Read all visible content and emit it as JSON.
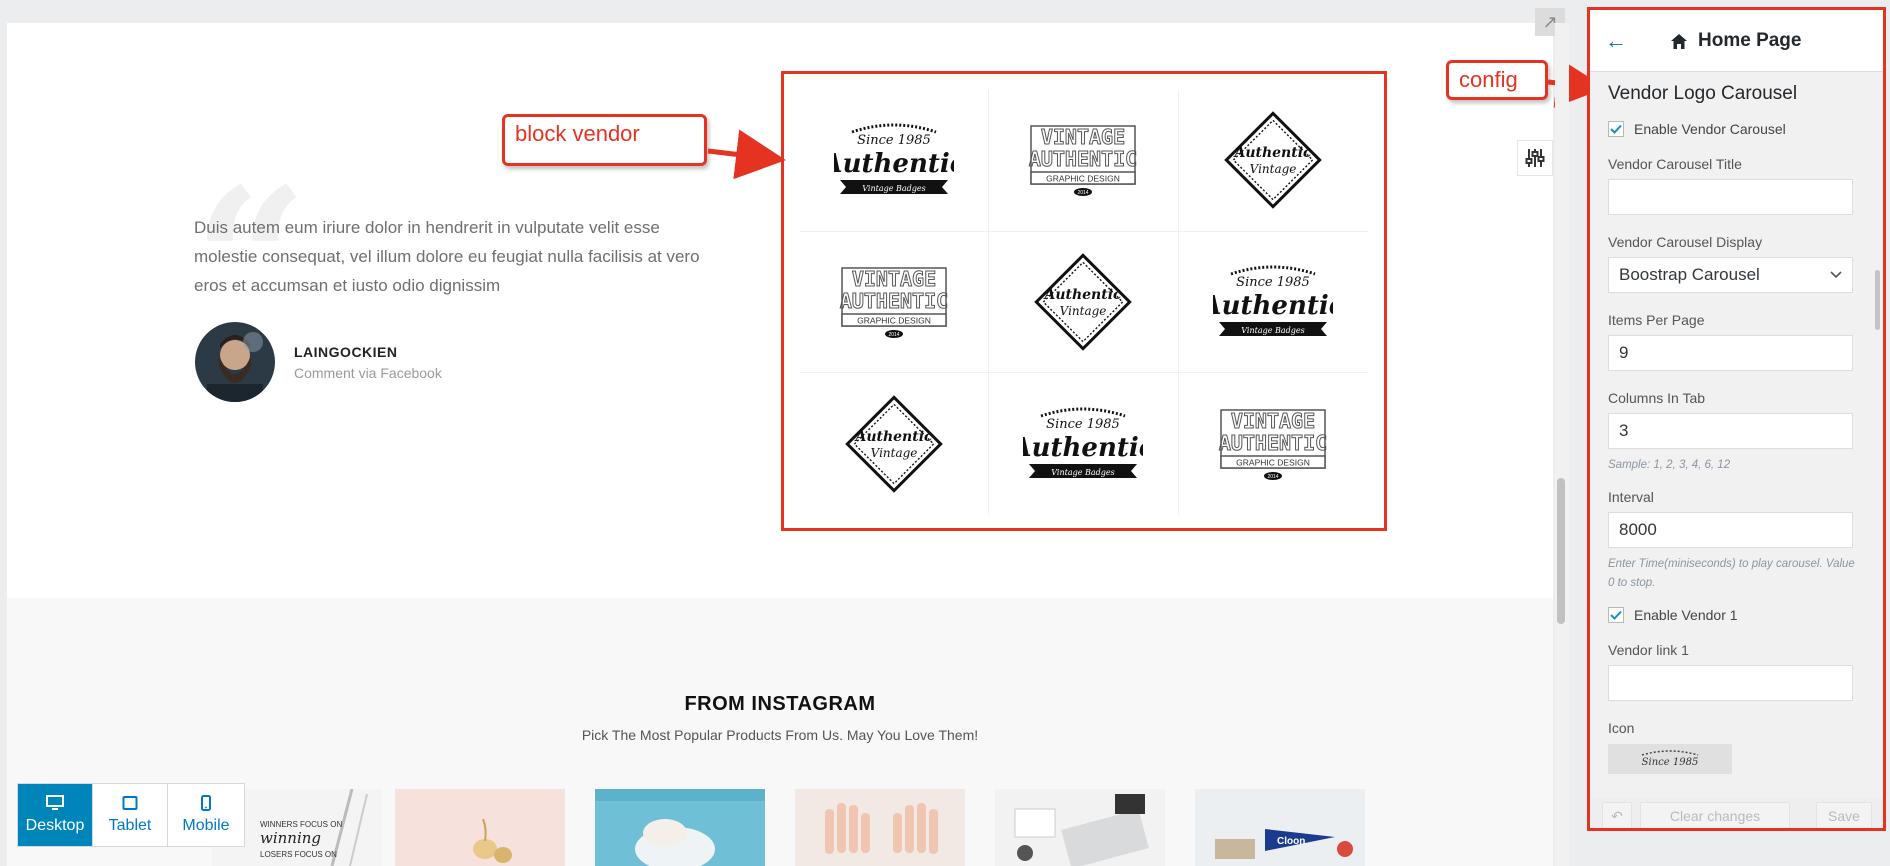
{
  "header": {
    "back_label": "←",
    "title": "Home Page"
  },
  "annotations": {
    "block_vendor": "block vendor",
    "config": "config"
  },
  "testimonial": {
    "text": " Duis autem eum iriure dolor in hendrerit in vulputate velit esse molestie consequat, vel illum dolore eu feugiat nulla facilisis at vero eros et accumsan et iusto odio dignissim",
    "author": "LAINGOCKIEN",
    "source": "Comment via Facebook"
  },
  "vendor_logos": [
    {
      "style": "authentic",
      "top": "Since 1985",
      "main": "Authentic",
      "ribbon": "Vintage Badges"
    },
    {
      "style": "vintage",
      "top": "VINTAGE",
      "main": "AUTHENTIC",
      "ribbon": "GRAPHIC DESIGN",
      "year": "2014"
    },
    {
      "style": "diamond",
      "main": "Authentic",
      "sub": "Vintage"
    },
    {
      "style": "vintage",
      "top": "VINTAGE",
      "main": "AUTHENTIC",
      "ribbon": "GRAPHIC DESIGN",
      "year": "2014"
    },
    {
      "style": "diamond",
      "main": "Authentic",
      "sub": "Vintage"
    },
    {
      "style": "authentic",
      "top": "Since 1985",
      "main": "Authentic",
      "ribbon": "Vintage Badges"
    },
    {
      "style": "diamond",
      "main": "Authentic",
      "sub": "Vintage"
    },
    {
      "style": "authentic",
      "top": "Since 1985",
      "main": "Authentic",
      "ribbon": "Vintage Badges"
    },
    {
      "style": "vintage",
      "top": "VINTAGE",
      "main": "AUTHENTIC",
      "ribbon": "GRAPHIC DESIGN",
      "year": "2014"
    }
  ],
  "instagram": {
    "title": "FROM INSTAGRAM",
    "subtitle": "Pick The Most Popular Products From Us. May You Love Them!",
    "thumb_text": "WINNERS FOCUS ON winning LOSERS FOCUS ON",
    "thumb_pennant": "Cloon"
  },
  "devices": [
    {
      "label": "Desktop",
      "icon": "desktop-icon",
      "active": true
    },
    {
      "label": "Tablet",
      "icon": "tablet-icon",
      "active": false
    },
    {
      "label": "Mobile",
      "icon": "mobile-icon",
      "active": false
    }
  ],
  "panel": {
    "section_title": "Vendor Logo Carousel",
    "enable_carousel_label": "Enable Vendor Carousel",
    "enable_carousel_checked": true,
    "carousel_title_label": "Vendor Carousel Title",
    "carousel_title_value": "",
    "carousel_display_label": "Vendor Carousel Display",
    "carousel_display_value": "Boostrap Carousel",
    "items_per_page_label": "Items Per Page",
    "items_per_page_value": "9",
    "columns_label": "Columns In Tab",
    "columns_value": "3",
    "columns_hint": "Sample: 1, 2, 3, 4, 6, 12",
    "interval_label": "Interval",
    "interval_value": "8000",
    "interval_hint": "Enter Time(miniseconds) to play carousel. Value 0 to stop.",
    "enable_vendor1_label": "Enable Vendor 1",
    "enable_vendor1_checked": true,
    "vendor_link1_label": "Vendor link 1",
    "vendor_link1_value": "",
    "icon_label": "Icon",
    "icon_thumb_text": "Since 1985"
  },
  "footer": {
    "undo_label": "↶",
    "clear_label": "Clear changes",
    "save_label": "Save"
  },
  "colors": {
    "annotation_red": "#e53321",
    "accent_blue": "#0085ba",
    "link_blue": "#0073aa"
  }
}
